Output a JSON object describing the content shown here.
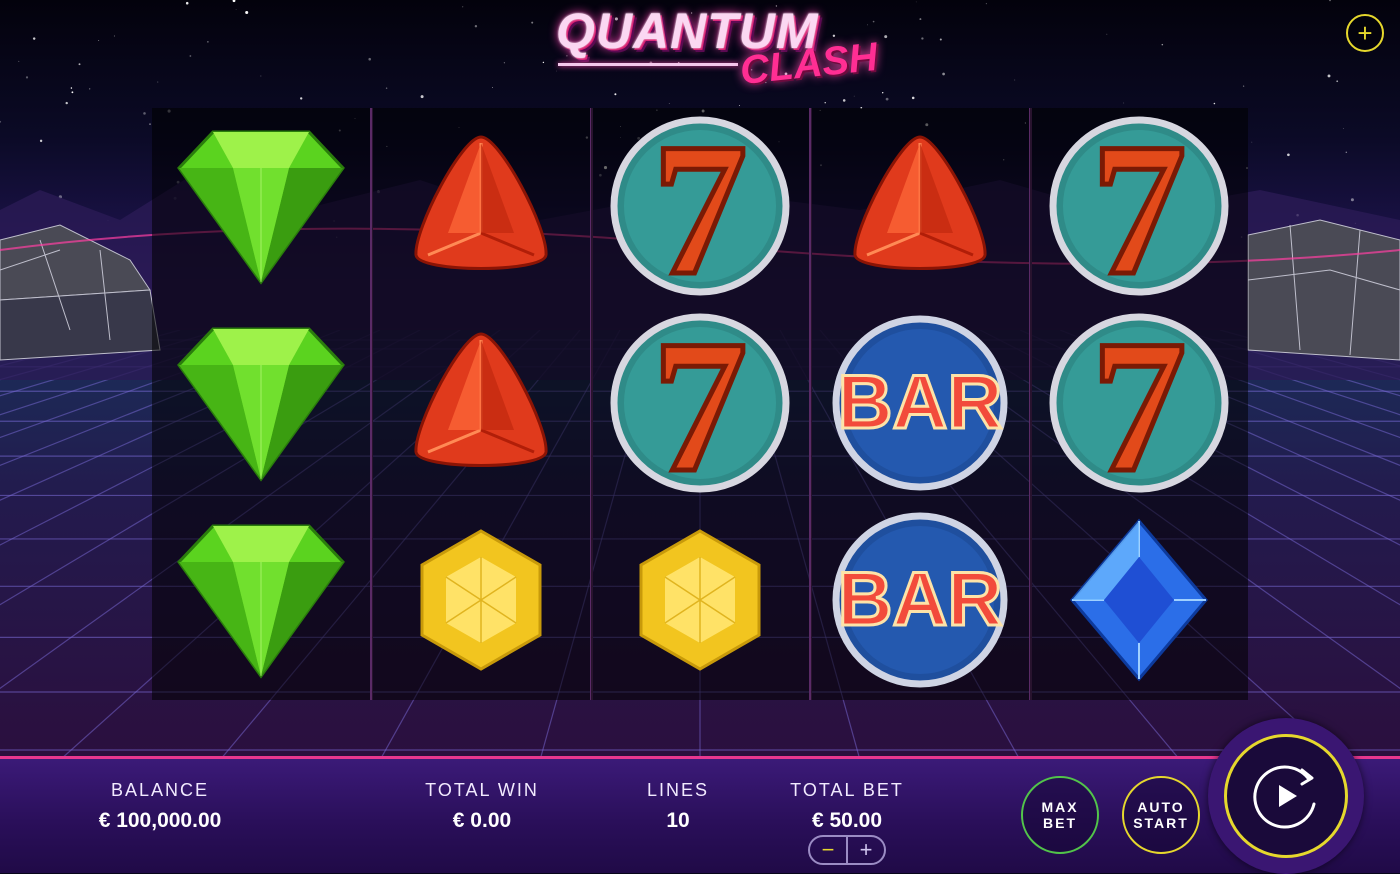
{
  "game": {
    "logo_main": "QUANTUM",
    "logo_sub": "CLASH"
  },
  "top_bar": {
    "add_label": "+"
  },
  "reels": [
    [
      "green-gem",
      "green-gem",
      "green-gem"
    ],
    [
      "red-gem",
      "red-gem",
      "yellow-gem"
    ],
    [
      "seven",
      "seven",
      "yellow-gem"
    ],
    [
      "red-gem",
      "bar",
      "bar"
    ],
    [
      "seven",
      "seven",
      "blue-gem"
    ]
  ],
  "symbol_text": {
    "seven": "7",
    "bar": "BAR"
  },
  "panel": {
    "balance_label": "BALANCE",
    "balance_value": "€ 100,000.00",
    "total_win_label": "TOTAL WIN",
    "total_win_value": "€ 0.00",
    "lines_label": "LINES",
    "lines_value": "10",
    "total_bet_label": "TOTAL BET",
    "total_bet_value": "€ 50.00",
    "bet_minus": "−",
    "bet_plus": "+",
    "max_bet_line1": "MAX",
    "max_bet_line2": "BET",
    "auto_start_line1": "AUTO",
    "auto_start_line2": "START"
  },
  "colors": {
    "accent_yellow": "#e6d82d",
    "accent_green": "#52c44a",
    "accent_pink": "#e8378f",
    "panel_purple": "#2a0f5a"
  },
  "icons": {
    "spin": "spin-play-icon",
    "add": "plus-icon"
  }
}
